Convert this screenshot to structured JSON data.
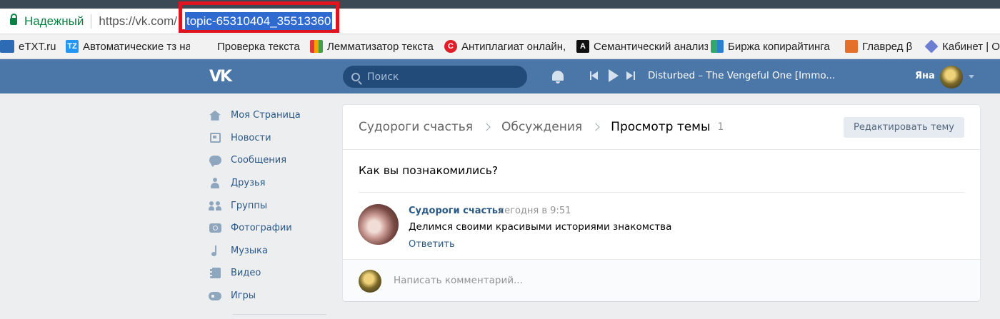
{
  "browser": {
    "secure_label": "Надежный",
    "url_prefix": "https://vk.com/",
    "url_highlight": "topic-65310404_35513360"
  },
  "bookmarks": [
    {
      "label": "eTXT.ru",
      "icon": "etxt-icon",
      "color": "#2d6cb5"
    },
    {
      "label": "Автоматические тз на",
      "icon": "tz-icon",
      "color": "#2196f3"
    },
    {
      "label": "Проверка текста",
      "icon": "",
      "color": ""
    },
    {
      "label": "Лемматизатор текста",
      "icon": "lemma-icon",
      "color": "#f4a300"
    },
    {
      "label": "Антиплагиат онлайн,",
      "icon": "antiplagiat-icon",
      "color": "#e01e27"
    },
    {
      "label": "Семантический анализ",
      "icon": "semantic-icon",
      "color": "#111111"
    },
    {
      "label": "Биржа копирайтинга",
      "icon": "birzha-icon",
      "color": "#33a66d"
    },
    {
      "label": "Главред β",
      "icon": "glavred-icon",
      "color": "#e36f2a"
    },
    {
      "label": "Кабинет | О",
      "icon": "cabinet-icon",
      "color": "#6b7ed1"
    }
  ],
  "header": {
    "logo": "vk",
    "search_placeholder": "Поиск",
    "track": "Disturbed – The Vengeful One [Immo...",
    "user_name": "Яна"
  },
  "nav": [
    {
      "label": "Моя Страница",
      "icon": "home-icon"
    },
    {
      "label": "Новости",
      "icon": "news-icon"
    },
    {
      "label": "Сообщения",
      "icon": "messages-icon"
    },
    {
      "label": "Друзья",
      "icon": "friends-icon"
    },
    {
      "label": "Группы",
      "icon": "groups-icon"
    },
    {
      "label": "Фотографии",
      "icon": "photos-icon"
    },
    {
      "label": "Музыка",
      "icon": "music-icon"
    },
    {
      "label": "Видео",
      "icon": "video-icon"
    },
    {
      "label": "Игры",
      "icon": "games-icon"
    }
  ],
  "topic": {
    "breadcrumbs": [
      "Судороги счастья",
      "Обсуждения",
      "Просмотр темы"
    ],
    "count": "1",
    "edit_button": "Редактировать тему",
    "title": "Как вы познакомились?",
    "post": {
      "author": "Судороги счастья",
      "date": "сегодня в 9:51",
      "text": "Делимся своими красивыми историями знакомства",
      "reply": "Ответить"
    },
    "comment_placeholder": "Написать комментарий..."
  },
  "colors": {
    "vk_header": "#4a76a8",
    "link": "#2a5885",
    "highlight_box": "#e0141e",
    "selection": "#2f6ad0"
  }
}
